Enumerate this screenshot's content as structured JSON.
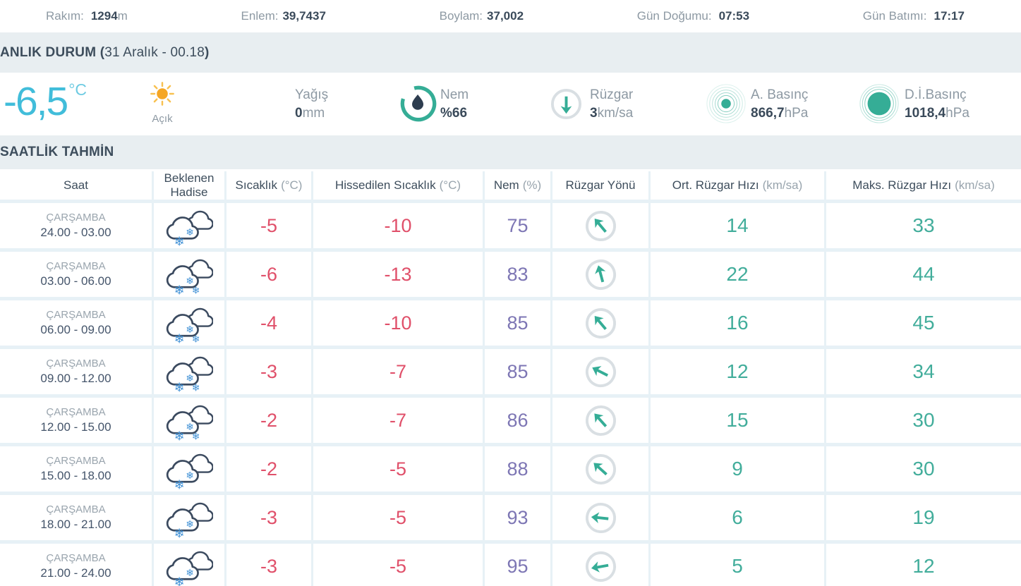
{
  "meta_bar": {
    "items": [
      {
        "label": "Rakım:",
        "value": "1294",
        "unit": "m"
      },
      {
        "label": "Enlem:",
        "value": "39,7437",
        "unit": ""
      },
      {
        "label": "Boylam:",
        "value": "37,002",
        "unit": ""
      },
      {
        "label": "Gün Doğumu:",
        "value": "07:53",
        "unit": ""
      },
      {
        "label": "Gün Batımı:",
        "value": "17:17",
        "unit": ""
      }
    ]
  },
  "current": {
    "title_prefix": "ANLIK DURUM (",
    "title_datetime": "31 Aralık - 00.18",
    "title_suffix": ")",
    "temperature": "-6,5",
    "temperature_unit": "°C",
    "condition_icon": "sun-icon",
    "condition_label": "Açık",
    "precipitation": {
      "label": "Yağış",
      "value": "0",
      "unit": "mm"
    },
    "humidity": {
      "label": "Nem",
      "prefix": "%",
      "value": "66",
      "icon": "humidity-gauge-icon"
    },
    "wind": {
      "label": "Rüzgar",
      "value": "3",
      "unit": "km/sa",
      "icon": "wind-down-arrow-icon"
    },
    "actual_pressure": {
      "label": "A. Basınç",
      "value": "866,7",
      "unit": "hPa",
      "icon": "pressure-ripple-dot-icon"
    },
    "sea_level_pressure": {
      "label": "D.İ.Basınç",
      "value": "1018,4",
      "unit": "hPa",
      "icon": "pressure-ripple-filled-icon"
    }
  },
  "hourly": {
    "section_title": "SAATLİK TAHMİN",
    "columns": [
      {
        "label": "Saat",
        "unit": ""
      },
      {
        "label": "Beklenen Hadise",
        "unit": ""
      },
      {
        "label": "Sıcaklık",
        "unit": "(°C)"
      },
      {
        "label": "Hissedilen Sıcaklık",
        "unit": "(°C)"
      },
      {
        "label": "Nem",
        "unit": "(%)"
      },
      {
        "label": "Rüzgar Yönü",
        "unit": ""
      },
      {
        "label": "Ort. Rüzgar Hızı",
        "unit": "(km/sa)"
      },
      {
        "label": "Maks. Rüzgar Hızı",
        "unit": "(km/sa)"
      }
    ],
    "rows": [
      {
        "day": "ÇARŞAMBA",
        "time": "24.00 - 03.00",
        "icon": "snow-cloud-icon",
        "flakes": 2,
        "temp": "-5",
        "feels": "-10",
        "humidity": "75",
        "wind_dir_deg": -40,
        "avg_wind": "14",
        "max_wind": "33"
      },
      {
        "day": "ÇARŞAMBA",
        "time": "03.00 - 06.00",
        "icon": "snow-cloud-icon",
        "flakes": 3,
        "temp": "-6",
        "feels": "-13",
        "humidity": "83",
        "wind_dir_deg": -15,
        "avg_wind": "22",
        "max_wind": "44"
      },
      {
        "day": "ÇARŞAMBA",
        "time": "06.00 - 09.00",
        "icon": "snow-cloud-icon",
        "flakes": 3,
        "temp": "-4",
        "feels": "-10",
        "humidity": "85",
        "wind_dir_deg": -40,
        "avg_wind": "16",
        "max_wind": "45"
      },
      {
        "day": "ÇARŞAMBA",
        "time": "09.00 - 12.00",
        "icon": "snow-cloud-icon",
        "flakes": 3,
        "temp": "-3",
        "feels": "-7",
        "humidity": "85",
        "wind_dir_deg": -63,
        "avg_wind": "12",
        "max_wind": "34"
      },
      {
        "day": "ÇARŞAMBA",
        "time": "12.00 - 15.00",
        "icon": "snow-cloud-icon",
        "flakes": 3,
        "temp": "-2",
        "feels": "-7",
        "humidity": "86",
        "wind_dir_deg": -42,
        "avg_wind": "15",
        "max_wind": "30"
      },
      {
        "day": "ÇARŞAMBA",
        "time": "15.00 - 18.00",
        "icon": "snow-cloud-icon",
        "flakes": 2,
        "temp": "-2",
        "feels": "-5",
        "humidity": "88",
        "wind_dir_deg": -48,
        "avg_wind": "9",
        "max_wind": "30"
      },
      {
        "day": "ÇARŞAMBA",
        "time": "18.00 - 21.00",
        "icon": "snow-cloud-icon",
        "flakes": 2,
        "temp": "-3",
        "feels": "-5",
        "humidity": "93",
        "wind_dir_deg": -84,
        "avg_wind": "6",
        "max_wind": "19"
      },
      {
        "day": "ÇARŞAMBA",
        "time": "21.00 - 24.00",
        "icon": "snow-cloud-icon",
        "flakes": 2,
        "temp": "-3",
        "feels": "-5",
        "humidity": "95",
        "wind_dir_deg": -100,
        "avg_wind": "5",
        "max_wind": "12"
      }
    ]
  },
  "colors": {
    "accent_teal": "#35ad96",
    "temperature_cyan": "#41bdda",
    "negative_temp_red": "#e0506a",
    "humidity_purple": "#7d76b4",
    "sun_orange": "#f5a623",
    "sun_ray_orange": "#f8c150",
    "dark_text": "#3a4a5a",
    "muted_text": "#8d99a3",
    "section_bar_bg": "#e8eef1",
    "table_gap_bg": "#e7f1f6",
    "cloud_outline": "#3b4a5f",
    "snowflake_blue": "#4292d6",
    "ring_gray": "#d9dfe3",
    "droplet_navy": "#2e3d4f"
  }
}
